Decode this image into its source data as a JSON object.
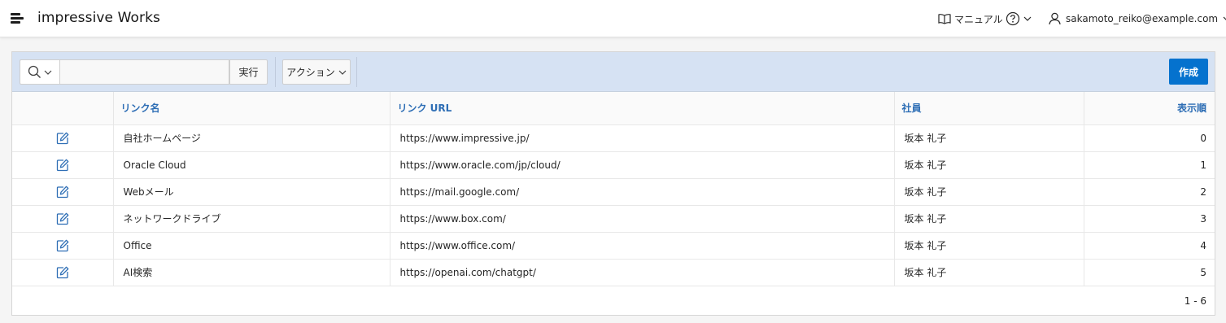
{
  "header": {
    "app_title": "impressive Works",
    "manual_label": "マニュアル",
    "user_email": "sakamoto_reiko@example.com"
  },
  "toolbar": {
    "search_value": "",
    "go_label": "実行",
    "actions_label": "アクション",
    "create_label": "作成"
  },
  "table": {
    "columns": [
      "",
      "リンク名",
      "リンク URL",
      "社員",
      "表示順"
    ],
    "rows": [
      {
        "name": "自社ホームページ",
        "url": "https://www.impressive.jp/",
        "employee": "坂本 礼子",
        "order": "0"
      },
      {
        "name": "Oracle Cloud",
        "url": "https://www.oracle.com/jp/cloud/",
        "employee": "坂本 礼子",
        "order": "1"
      },
      {
        "name": "Webメール",
        "url": "https://mail.google.com/",
        "employee": "坂本 礼子",
        "order": "2"
      },
      {
        "name": "ネットワークドライブ",
        "url": "https://www.box.com/",
        "employee": "坂本 礼子",
        "order": "3"
      },
      {
        "name": "Office",
        "url": "https://www.office.com/",
        "employee": "坂本 礼子",
        "order": "4"
      },
      {
        "name": "AI検索",
        "url": "https://openai.com/chatgpt/",
        "employee": "坂本 礼子",
        "order": "5"
      }
    ],
    "pagination": "1 - 6"
  },
  "colors": {
    "accent": "#0572ce",
    "toolbar_bg": "#d6e2f3",
    "header_link": "#2e6eb5",
    "icon": "#2e6eb5"
  },
  "icons": [
    "menu-icon",
    "book-icon",
    "help-icon",
    "chevron-down-icon",
    "user-icon",
    "search-icon",
    "edit-icon"
  ]
}
